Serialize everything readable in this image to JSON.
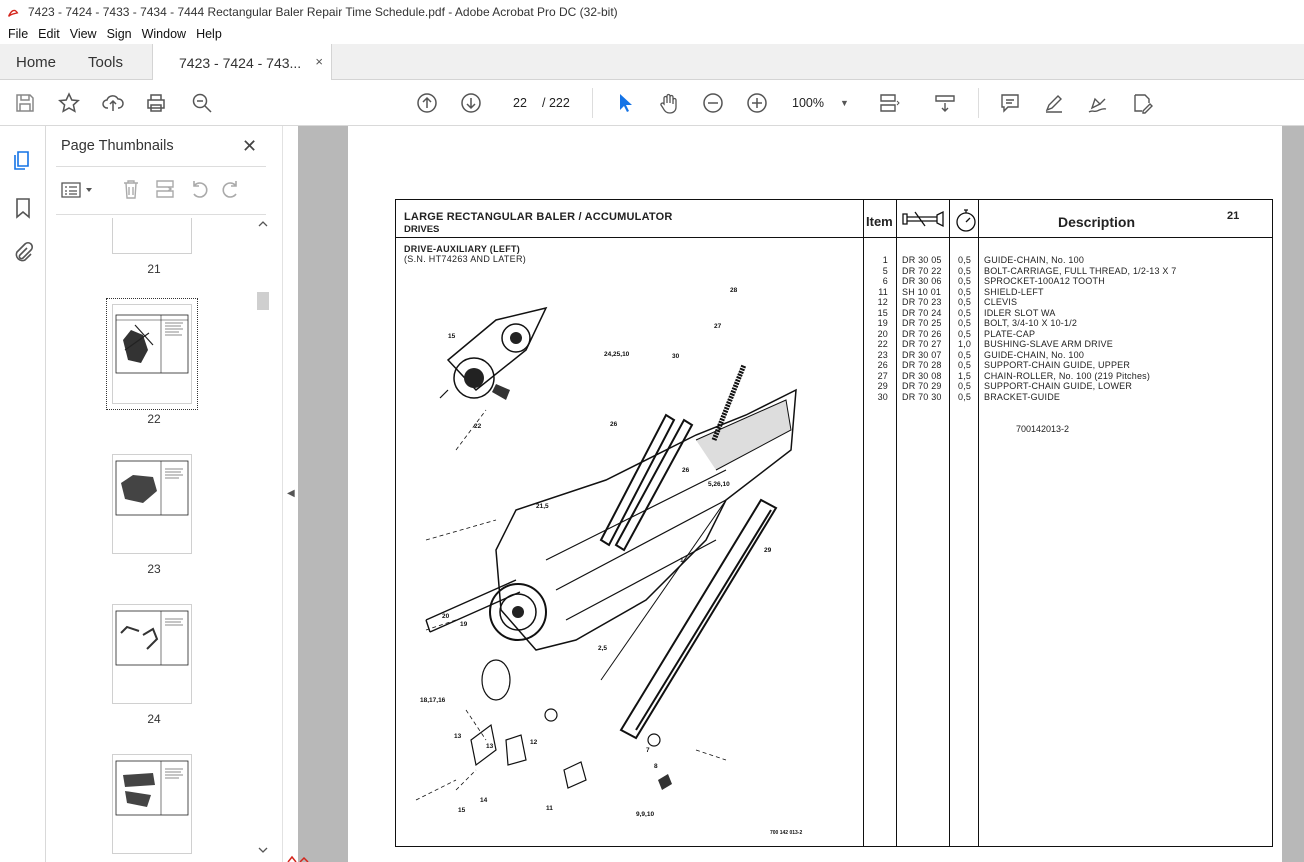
{
  "window": {
    "title": "7423 - 7424 - 7433 - 7434 - 7444 Rectangular Baler Repair Time Schedule.pdf - Adobe Acrobat Pro DC (32-bit)"
  },
  "menu": [
    "File",
    "Edit",
    "View",
    "Sign",
    "Window",
    "Help"
  ],
  "tabs": {
    "home": "Home",
    "tools": "Tools",
    "doc": "7423 - 7424 - 743...",
    "close": "×"
  },
  "toolbar": {
    "page_current": "22",
    "page_total": "/ 222",
    "zoom": "100%"
  },
  "panel": {
    "title": "Page Thumbnails",
    "close": "✕"
  },
  "thumbnails": [
    {
      "label": "21"
    },
    {
      "label": "22",
      "selected": true
    },
    {
      "label": "23"
    },
    {
      "label": "24"
    }
  ],
  "page": {
    "header_title": "LARGE RECTANGULAR BALER / ACCUMULATOR",
    "header_subtitle": "DRIVES",
    "col_item": "Item",
    "col_description": "Description",
    "page_number": "21",
    "section_title": "DRIVE-AUXILIARY (LEFT)",
    "section_sub": "(S.N. HT74263 AND LATER)",
    "rows": [
      {
        "item": "1",
        "code": "DR 30 05",
        "time": "0,5",
        "desc": "GUIDE-CHAIN, No. 100"
      },
      {
        "item": "5",
        "code": "DR 70 22",
        "time": "0,5",
        "desc": "BOLT-CARRIAGE, FULL THREAD, 1/2-13 X 7"
      },
      {
        "item": "6",
        "code": "DR 30 06",
        "time": "0,5",
        "desc": "SPROCKET-100A12 TOOTH"
      },
      {
        "item": "11",
        "code": "SH 10 01",
        "time": "0,5",
        "desc": "SHIELD-LEFT"
      },
      {
        "item": "12",
        "code": "DR 70 23",
        "time": "0,5",
        "desc": "CLEVIS"
      },
      {
        "item": "15",
        "code": "DR 70 24",
        "time": "0,5",
        "desc": "IDLER SLOT WA"
      },
      {
        "item": "19",
        "code": "DR 70 25",
        "time": "0,5",
        "desc": "BOLT, 3/4-10 X 10-1/2"
      },
      {
        "item": "20",
        "code": "DR 70 26",
        "time": "0,5",
        "desc": "PLATE-CAP"
      },
      {
        "item": "22",
        "code": "DR 70 27",
        "time": "1,0",
        "desc": "BUSHING-SLAVE ARM DRIVE"
      },
      {
        "item": "23",
        "code": "DR 30 07",
        "time": "0,5",
        "desc": "GUIDE-CHAIN, No. 100"
      },
      {
        "item": "26",
        "code": "DR 70 28",
        "time": "0,5",
        "desc": "SUPPORT-CHAIN GUIDE, UPPER"
      },
      {
        "item": "27",
        "code": "DR 30 08",
        "time": "1,5",
        "desc": "CHAIN-ROLLER, No. 100 (219 Pitches)"
      },
      {
        "item": "29",
        "code": "DR 70 29",
        "time": "0,5",
        "desc": "SUPPORT-CHAIN GUIDE, LOWER"
      },
      {
        "item": "30",
        "code": "DR 70 30",
        "time": "0,5",
        "desc": "BRACKET-GUIDE"
      }
    ],
    "reference": "700142013-2",
    "callouts": [
      "15",
      "22",
      "28",
      "27",
      "24,25,10",
      "30",
      "26",
      "26",
      "5,26,10",
      "21,5",
      "29",
      "20",
      "19",
      "2,5",
      "1",
      "8",
      "7",
      "18,17,16",
      "13",
      "12",
      "13",
      "14",
      "15",
      "11",
      "9,9,10",
      "700 142 013-2"
    ]
  },
  "colors": {
    "acrobat_red": "#d4251c",
    "selection_blue": "#1473e6",
    "doc_bg": "#b8b8b8"
  }
}
